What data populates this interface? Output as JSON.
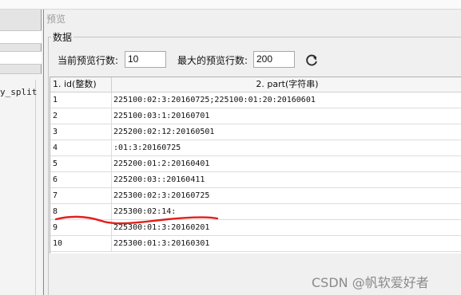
{
  "background": {
    "left_fragment_text": "y_split"
  },
  "dialog": {
    "title": "预览",
    "group_title": "数据",
    "current_preview_rows_label": "当前预览行数:",
    "current_preview_rows_value": "10",
    "max_preview_rows_label": "最大的预览行数:",
    "max_preview_rows_value": "200",
    "refresh_icon": "refresh-icon"
  },
  "table": {
    "columns": [
      "1. id(整数)",
      "2. part(字符串)"
    ],
    "rows": [
      {
        "id": "1",
        "part": "225100:02:3:20160725;225100:01:20:20160601"
      },
      {
        "id": "2",
        "part": "225100:03:1:20160701"
      },
      {
        "id": "3",
        "part": "225200:02:12:20160501"
      },
      {
        "id": "4",
        "part": ":01:3:20160725"
      },
      {
        "id": "5",
        "part": "225200:01:2:20160401"
      },
      {
        "id": "6",
        "part": "225200:03::20160411"
      },
      {
        "id": "7",
        "part": "225300:02:3:20160725"
      },
      {
        "id": "8",
        "part": "225300:02:14:"
      },
      {
        "id": "9",
        "part": "225300:01:3:20160201"
      },
      {
        "id": "10",
        "part": "225300:01:3:20160301"
      }
    ]
  },
  "annotation": {
    "color": "#e0201c"
  },
  "watermark": "CSDN @帆软爱好者"
}
